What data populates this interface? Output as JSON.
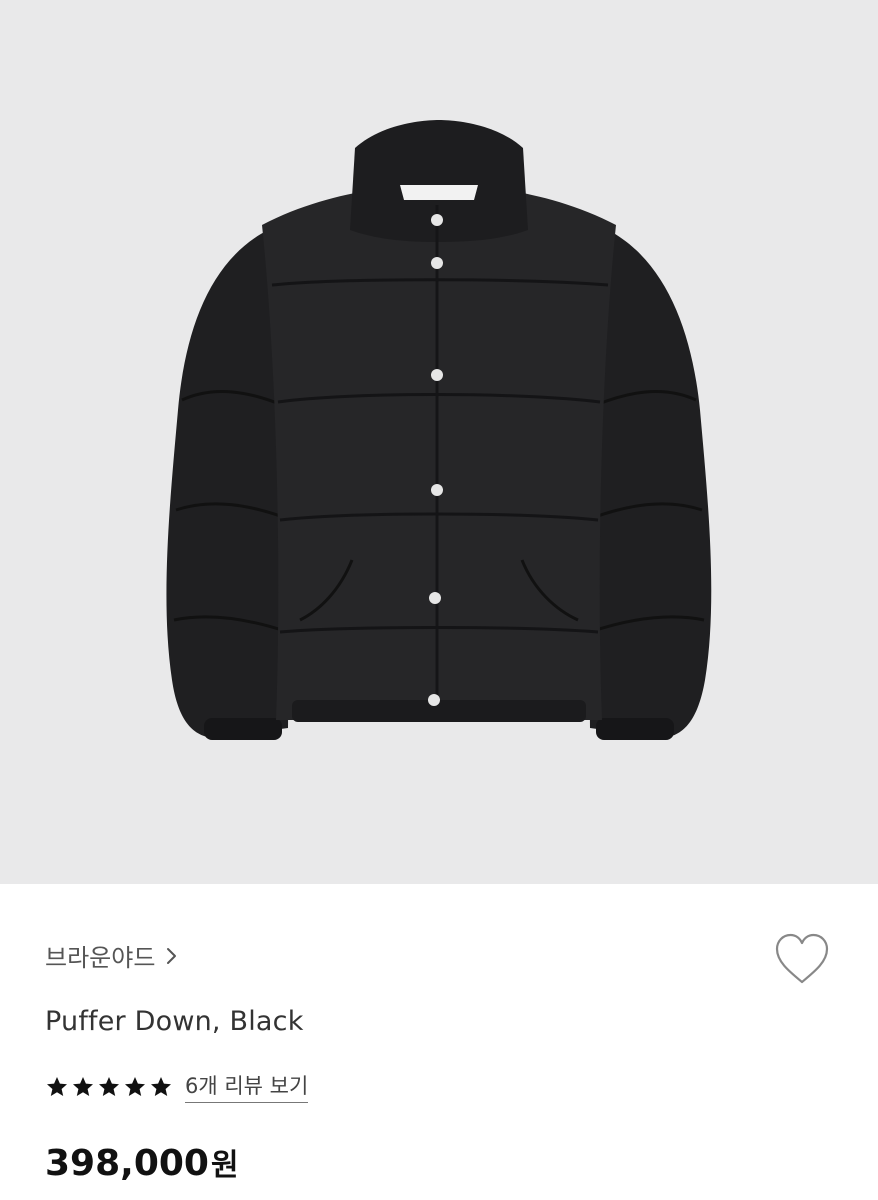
{
  "product": {
    "brand": "브라운야드",
    "name": "Puffer Down, Black",
    "rating_stars": 5,
    "review_link": "6개 리뷰 보기",
    "price_amount": "398,000",
    "price_unit": "원"
  },
  "icons": {
    "brand_chevron": "chevron-right-icon",
    "wish": "heart-outline-icon",
    "rating": "star-icon"
  },
  "colors": {
    "image_background": "#e9e9ea",
    "jacket": "#232325",
    "star": "#111111",
    "text_primary": "#111111",
    "text_secondary": "#555555"
  }
}
